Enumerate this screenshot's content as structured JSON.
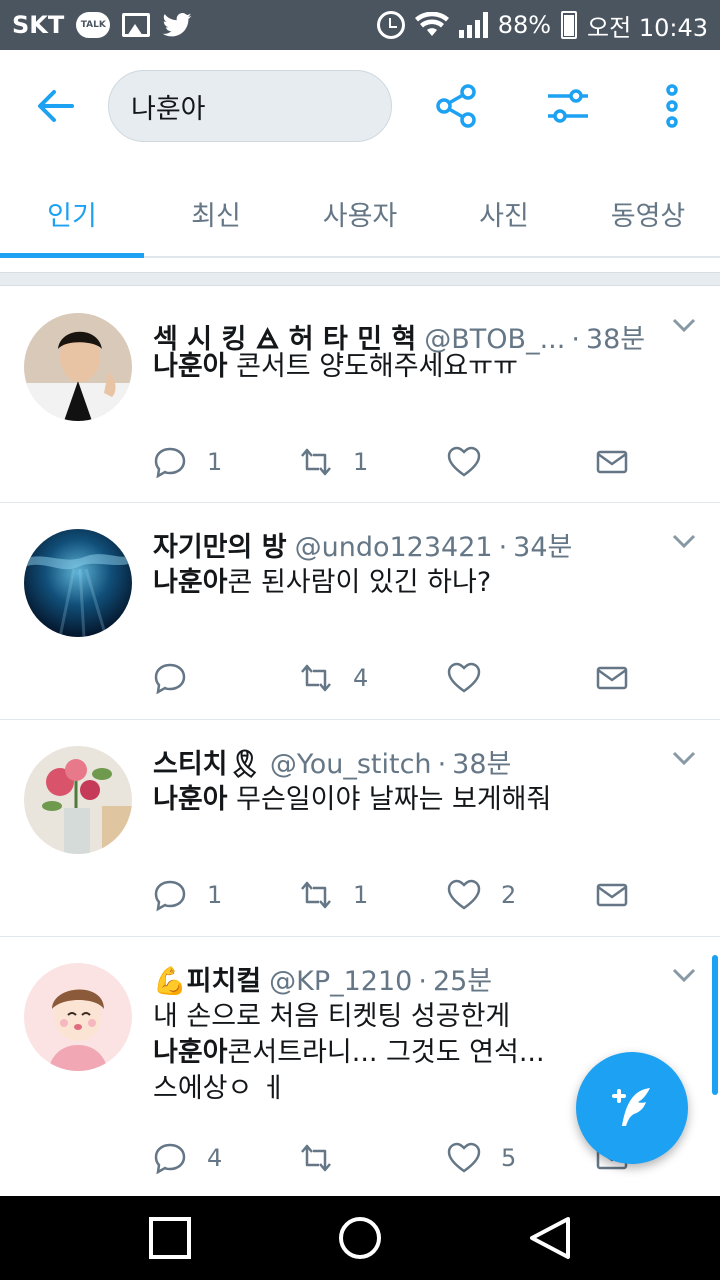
{
  "status_bar": {
    "carrier": "SKT",
    "talk_icon_label": "TALK",
    "battery": "88%",
    "time": "오전 10:43"
  },
  "search": {
    "query": "나훈아"
  },
  "tabs": [
    {
      "label": "인기",
      "active": true
    },
    {
      "label": "최신",
      "active": false
    },
    {
      "label": "사용자",
      "active": false
    },
    {
      "label": "사진",
      "active": false
    },
    {
      "label": "동영상",
      "active": false
    }
  ],
  "tweets": [
    {
      "name": "섹 시 킹 🜁 허 타 민 혁",
      "handle": "@BTOB_...",
      "time": "38분",
      "body_bold": "나훈아",
      "body_rest": " 콘서트 양도해주세요ㅠㅠ",
      "replies": "1",
      "retweets": "1",
      "likes": ""
    },
    {
      "name": "자기만의 방",
      "handle": "@undo123421",
      "time": "34분",
      "body_bold": "나훈아",
      "body_rest": "콘 된사람이 있긴 하나?",
      "replies": "",
      "retweets": "4",
      "likes": ""
    },
    {
      "name": "스티치🎗",
      "handle": "@You_stitch",
      "time": "38분",
      "body_bold": "나훈아",
      "body_rest": " 무슨일이야 날짜는 보게해줘",
      "replies": "1",
      "retweets": "1",
      "likes": "2"
    },
    {
      "name": "💪피치컬",
      "handle": "@KP_1210",
      "time": "25분",
      "body_line1": "내 손으로 처음 티켓팅 성공한게",
      "body_bold": "나훈아",
      "body_rest": "콘서트라니... 그것도 연석...",
      "body_line3": "스에상ㅇ ㅔ",
      "replies": "4",
      "retweets": "",
      "likes": "5"
    }
  ],
  "colors": {
    "accent": "#1da1f2",
    "status_bar": "#4b5560",
    "muted": "#657786"
  }
}
